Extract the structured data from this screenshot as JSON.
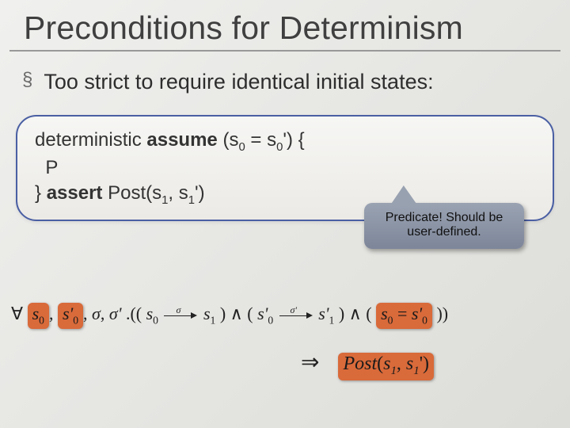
{
  "title": "Preconditions for Determinism",
  "bullet": {
    "marker": "§",
    "text": "Too strict to require identical initial states:"
  },
  "code": {
    "kw_det": "deterministic",
    "kw_assume": "assume",
    "paren_open": "(s",
    "sub0a": "0",
    "eq": " = s",
    "sub0b": "0",
    "prime_close": "') {",
    "line2": "  P",
    "brace_close": "}",
    "kw_assert": "assert",
    "post_lbl": " Post(s",
    "sub1a": "1",
    "comma": ", s",
    "sub1b": "1",
    "prime_end": "')"
  },
  "callout": {
    "line1": "Predicate! Should be",
    "line2": "user-defined."
  },
  "formula": {
    "forall": "∀",
    "s0": "s",
    "s0p": "s'",
    "sigma": "σ",
    "sigmap": "σ'",
    "dot": ".((",
    "arrow_lbl1": "σ",
    "mid1": ") ∧ (",
    "arrow_lbl2": "σ'",
    "mid2": ") ∧ (",
    "eqpart_l": "s",
    "eqpart_eq": " = ",
    "eqpart_r": "s'",
    "close": "))",
    "implies": "⇒",
    "post": "Post",
    "post_args_open": "(",
    "post_s1": "s",
    "post_comma": ", ",
    "post_s1p": "s",
    "post_args_close": "')",
    "sub0": "0",
    "sub1": "1"
  }
}
